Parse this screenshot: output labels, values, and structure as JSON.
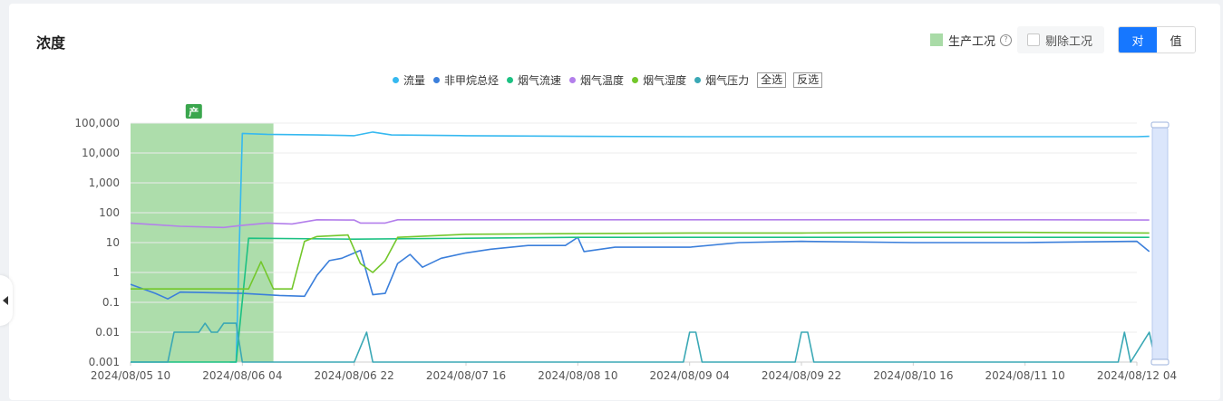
{
  "panel": {
    "title": "浓度",
    "production_legend_label": "生产工况",
    "exclude_label": "剔除工况",
    "toggle": {
      "left": "对",
      "right": "值",
      "selected": "对"
    },
    "production_marker": "产",
    "select_all": "全选",
    "invert": "反选",
    "help_icon": "?"
  },
  "chart_data": {
    "type": "line",
    "y_scale": "log",
    "ylim": [
      0.001,
      100000
    ],
    "y_ticks": [
      "100,000",
      "10,000",
      "1,000",
      "100",
      "10",
      "1",
      "0.1",
      "0.01",
      "0.001"
    ],
    "x_ticks": [
      "2024/08/05 10",
      "2024/08/06 04",
      "2024/08/06 22",
      "2024/08/07 16",
      "2024/08/08 10",
      "2024/08/09 04",
      "2024/08/09 22",
      "2024/08/10 16",
      "2024/08/11 10",
      "2024/08/12 04"
    ],
    "grid": true,
    "production_band": [
      "2024/08/05 10",
      "2024/08/06 09"
    ],
    "series": [
      {
        "name": "流量",
        "color": "#36b9f0",
        "points": [
          [
            "2024/08/06 02",
            0.001
          ],
          [
            "2024/08/06 03",
            0.001
          ],
          [
            "2024/08/06 04",
            45000
          ],
          [
            "2024/08/06 08",
            42000
          ],
          [
            "2024/08/06 16",
            40000
          ],
          [
            "2024/08/06 22",
            38000
          ],
          [
            "2024/08/07 01",
            50000
          ],
          [
            "2024/08/07 04",
            40000
          ],
          [
            "2024/08/07 16",
            38000
          ],
          [
            "2024/08/08 10",
            36000
          ],
          [
            "2024/08/09 04",
            35000
          ],
          [
            "2024/08/09 22",
            35000
          ],
          [
            "2024/08/10 16",
            35000
          ],
          [
            "2024/08/11 10",
            35000
          ],
          [
            "2024/08/12 04",
            35000
          ],
          [
            "2024/08/12 06",
            36000
          ]
        ]
      },
      {
        "name": "非甲烷总烃",
        "color": "#3b7fdb",
        "points": [
          [
            "2024/08/05 10",
            0.4
          ],
          [
            "2024/08/05 14",
            0.2
          ],
          [
            "2024/08/05 16",
            0.13
          ],
          [
            "2024/08/05 18",
            0.22
          ],
          [
            "2024/08/06 04",
            0.2
          ],
          [
            "2024/08/06 10",
            0.17
          ],
          [
            "2024/08/06 14",
            0.16
          ],
          [
            "2024/08/06 16",
            0.8
          ],
          [
            "2024/08/06 18",
            2.5
          ],
          [
            "2024/08/06 20",
            3
          ],
          [
            "2024/08/06 23",
            5.5
          ],
          [
            "2024/08/07 01",
            0.18
          ],
          [
            "2024/08/07 03",
            0.2
          ],
          [
            "2024/08/07 05",
            2
          ],
          [
            "2024/08/07 07",
            4
          ],
          [
            "2024/08/07 09",
            1.5
          ],
          [
            "2024/08/07 12",
            3
          ],
          [
            "2024/08/07 16",
            4.5
          ],
          [
            "2024/08/07 20",
            6
          ],
          [
            "2024/08/08 02",
            8
          ],
          [
            "2024/08/08 08",
            8
          ],
          [
            "2024/08/08 10",
            15
          ],
          [
            "2024/08/08 11",
            5
          ],
          [
            "2024/08/08 16",
            7
          ],
          [
            "2024/08/09 04",
            7
          ],
          [
            "2024/08/09 12",
            10
          ],
          [
            "2024/08/09 22",
            11
          ],
          [
            "2024/08/10 16",
            10
          ],
          [
            "2024/08/11 10",
            10
          ],
          [
            "2024/08/12 04",
            11
          ],
          [
            "2024/08/12 06",
            5
          ]
        ]
      },
      {
        "name": "烟气流速",
        "color": "#1cc183",
        "points": [
          [
            "2024/08/05 10",
            0.001
          ],
          [
            "2024/08/06 03",
            0.001
          ],
          [
            "2024/08/06 05",
            14
          ],
          [
            "2024/08/06 22",
            13
          ],
          [
            "2024/08/07 16",
            14
          ],
          [
            "2024/08/08 10",
            15
          ],
          [
            "2024/08/09 04",
            15
          ],
          [
            "2024/08/09 22",
            15
          ],
          [
            "2024/08/10 16",
            15
          ],
          [
            "2024/08/11 10",
            15
          ],
          [
            "2024/08/12 06",
            15
          ]
        ]
      },
      {
        "name": "烟气温度",
        "color": "#b37feb",
        "points": [
          [
            "2024/08/05 10",
            45
          ],
          [
            "2024/08/05 18",
            35
          ],
          [
            "2024/08/06 01",
            32
          ],
          [
            "2024/08/06 04",
            38
          ],
          [
            "2024/08/06 08",
            45
          ],
          [
            "2024/08/06 12",
            42
          ],
          [
            "2024/08/06 16",
            58
          ],
          [
            "2024/08/06 22",
            57
          ],
          [
            "2024/08/06 23",
            45
          ],
          [
            "2024/08/07 03",
            45
          ],
          [
            "2024/08/07 05",
            58
          ],
          [
            "2024/08/07 16",
            58
          ],
          [
            "2024/08/08 10",
            58
          ],
          [
            "2024/08/09 04",
            58
          ],
          [
            "2024/08/09 22",
            58
          ],
          [
            "2024/08/10 16",
            58
          ],
          [
            "2024/08/11 10",
            58
          ],
          [
            "2024/08/12 06",
            57
          ]
        ]
      },
      {
        "name": "烟气湿度",
        "color": "#73c72b",
        "points": [
          [
            "2024/08/05 10",
            0.28
          ],
          [
            "2024/08/06 05",
            0.28
          ],
          [
            "2024/08/06 07",
            2.3
          ],
          [
            "2024/08/06 09",
            0.28
          ],
          [
            "2024/08/06 12",
            0.28
          ],
          [
            "2024/08/06 14",
            11
          ],
          [
            "2024/08/06 16",
            16
          ],
          [
            "2024/08/06 21",
            18
          ],
          [
            "2024/08/06 23",
            2
          ],
          [
            "2024/08/07 01",
            1
          ],
          [
            "2024/08/07 03",
            2.5
          ],
          [
            "2024/08/07 05",
            15
          ],
          [
            "2024/08/07 16",
            19
          ],
          [
            "2024/08/08 10",
            20
          ],
          [
            "2024/08/09 04",
            21
          ],
          [
            "2024/08/09 22",
            21
          ],
          [
            "2024/08/10 16",
            22
          ],
          [
            "2024/08/11 10",
            22
          ],
          [
            "2024/08/12 06",
            21
          ]
        ]
      },
      {
        "name": "烟气压力",
        "color": "#3aa8b5",
        "points": [
          [
            "2024/08/05 10",
            0.001
          ],
          [
            "2024/08/05 16",
            0.001
          ],
          [
            "2024/08/05 17",
            0.01
          ],
          [
            "2024/08/05 21",
            0.01
          ],
          [
            "2024/08/05 22",
            0.02
          ],
          [
            "2024/08/05 23",
            0.01
          ],
          [
            "2024/08/06 00",
            0.01
          ],
          [
            "2024/08/06 01",
            0.02
          ],
          [
            "2024/08/06 03",
            0.02
          ],
          [
            "2024/08/06 04",
            0.001
          ],
          [
            "2024/08/06 22",
            0.001
          ],
          [
            "2024/08/07 00",
            0.01
          ],
          [
            "2024/08/07 01",
            0.001
          ],
          [
            "2024/08/09 03",
            0.001
          ],
          [
            "2024/08/09 04",
            0.01
          ],
          [
            "2024/08/09 05",
            0.01
          ],
          [
            "2024/08/09 06",
            0.001
          ],
          [
            "2024/08/09 21",
            0.001
          ],
          [
            "2024/08/09 22",
            0.01
          ],
          [
            "2024/08/09 23",
            0.01
          ],
          [
            "2024/08/10 00",
            0.001
          ],
          [
            "2024/08/12 01",
            0.001
          ],
          [
            "2024/08/12 02",
            0.01
          ],
          [
            "2024/08/12 03",
            0.001
          ],
          [
            "2024/08/12 06",
            0.01
          ],
          [
            "2024/08/12 07",
            0.001
          ],
          [
            "2024/08/12 08",
            0.001
          ]
        ]
      }
    ]
  }
}
